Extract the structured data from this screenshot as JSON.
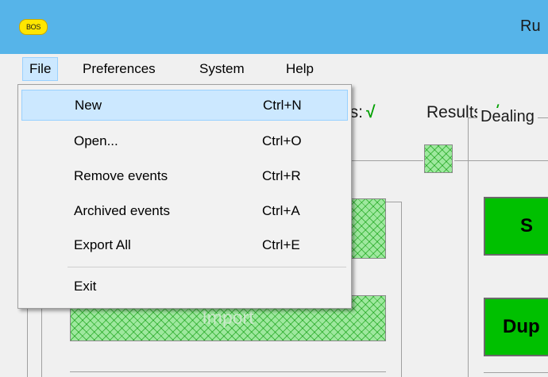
{
  "app": {
    "icon_text": "BOS",
    "title": "Ru"
  },
  "menubar": {
    "items": [
      "File",
      "Preferences",
      "System",
      "Help"
    ]
  },
  "file_menu": {
    "items": [
      {
        "label": "New",
        "shortcut": "Ctrl+N"
      },
      {
        "label": "Open...",
        "shortcut": "Ctrl+O"
      },
      {
        "label": "Remove events",
        "shortcut": "Ctrl+R"
      },
      {
        "label": "Archived events",
        "shortcut": "Ctrl+A"
      },
      {
        "label": "Export All",
        "shortcut": "Ctrl+E"
      }
    ],
    "exit_label": "Exit"
  },
  "status": {
    "partial_label": "ls:",
    "results_label": "Results:",
    "check_glyph": "√"
  },
  "buttons": {
    "import_label": "Import",
    "s_label": "S",
    "dup_label": "Dup"
  },
  "dealing_group_label": "Dealing",
  "colors": {
    "titlebar": "#56b4e9",
    "menu_highlight": "#cce8ff",
    "green_button": "#00c000",
    "check": "#00a000"
  }
}
